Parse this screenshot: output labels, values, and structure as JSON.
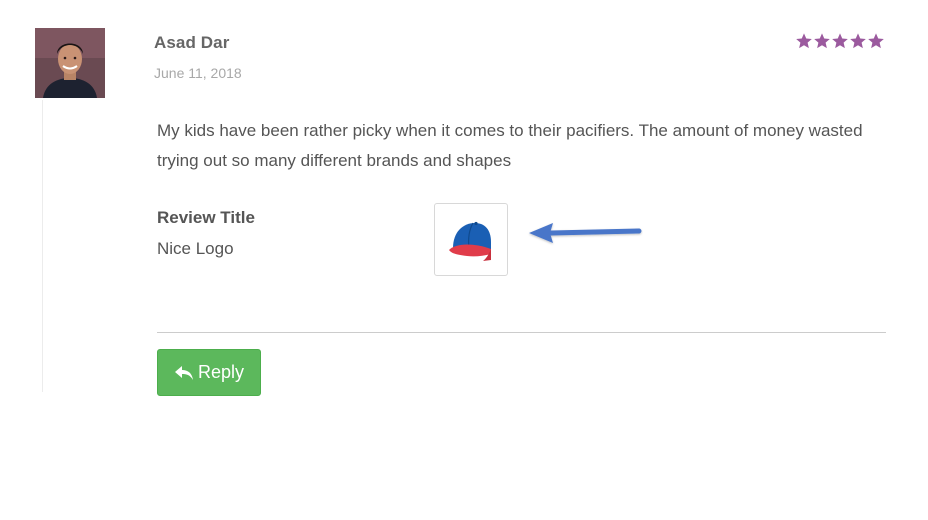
{
  "review": {
    "author": "Asad Dar",
    "date": "June 11, 2018",
    "rating": 5,
    "rating_max": 5,
    "star_color": "#9b5a9e",
    "text": "My kids have been rather picky when it comes to their pacifiers. The amount of money wasted trying out so many different brands and shapes",
    "field_label": "Review Title",
    "field_value": "Nice Logo",
    "attachment_icon": "baseball-cap-icon",
    "annotation_icon": "arrow-left-icon",
    "annotation_color": "#4a76c9"
  },
  "actions": {
    "reply_label": "Reply",
    "reply_icon": "reply-icon",
    "reply_color": "#5cb85c"
  }
}
